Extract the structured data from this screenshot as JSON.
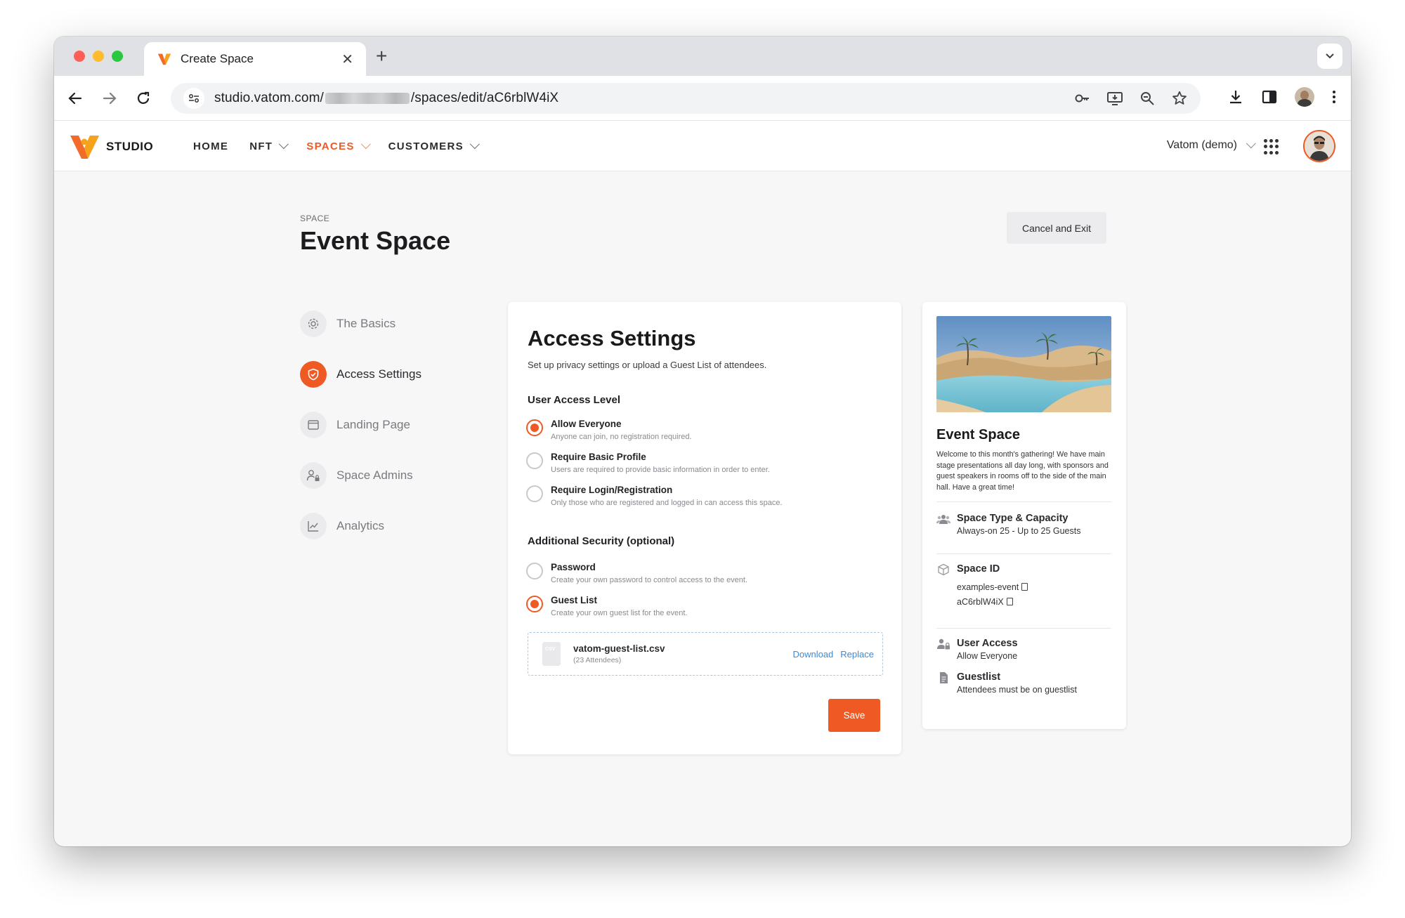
{
  "browser": {
    "tab_title": "Create Space",
    "url_host": "studio.vatom.com/",
    "url_path": "/spaces/edit/aC6rblW4iX"
  },
  "app": {
    "logo_text": "STUDIO",
    "nav": [
      {
        "label": "HOME"
      },
      {
        "label": "NFT"
      },
      {
        "label": "SPACES"
      },
      {
        "label": "CUSTOMERS"
      }
    ],
    "account": "Vatom (demo)",
    "accent": "#ef5a24"
  },
  "page": {
    "crumb": "SPACE",
    "title": "Event Space",
    "cancel_label": "Cancel and Exit"
  },
  "steps": [
    {
      "label": "The Basics",
      "icon": "gear-icon"
    },
    {
      "label": "Access Settings",
      "icon": "shield-icon"
    },
    {
      "label": "Landing Page",
      "icon": "browser-window-icon"
    },
    {
      "label": "Space Admins",
      "icon": "user-lock-icon"
    },
    {
      "label": "Analytics",
      "icon": "chart-line-icon"
    }
  ],
  "access": {
    "title": "Access Settings",
    "subtitle": "Set up privacy settings or upload a Guest List of attendees.",
    "user_access_title": "User Access Level",
    "user_access_options": [
      {
        "label": "Allow Everyone",
        "desc": "Anyone can join, no registration required."
      },
      {
        "label": "Require Basic Profile",
        "desc": "Users are required to provide basic information in order to enter."
      },
      {
        "label": "Require Login/Registration",
        "desc": "Only those who are registered and logged in can access this space."
      }
    ],
    "security_title": "Additional Security (optional)",
    "security_options": [
      {
        "label": "Password",
        "desc": "Create your own password to control access to the event."
      },
      {
        "label": "Guest List",
        "desc": "Create your own guest list for the event."
      }
    ],
    "file": {
      "name": "vatom-guest-list.csv",
      "meta": "(23 Attendees)",
      "download": "Download",
      "replace": "Replace"
    },
    "save_label": "Save"
  },
  "preview": {
    "title": "Event Space",
    "description": "Welcome to this month's gathering! We have main stage presentations all day long, with sponsors and guest speakers in rooms off to the side of the main hall. Have a great time!",
    "type_label": "Space Type & Capacity",
    "type_value": "Always-on 25 - Up to 25 Guests",
    "id_label": "Space ID",
    "id_slug": "examples-event",
    "id_code": "aC6rblW4iX",
    "user_access_label": "User Access",
    "user_access_value": "Allow Everyone",
    "guestlist_label": "Guestlist",
    "guestlist_value": "Attendees must be on guestlist"
  }
}
